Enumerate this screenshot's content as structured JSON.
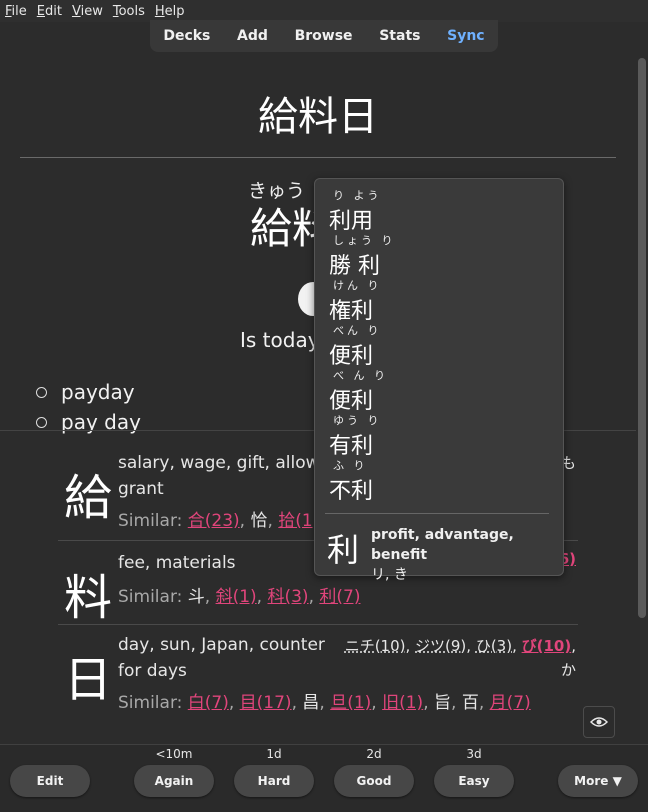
{
  "menubar": {
    "items": [
      {
        "u": "F",
        "rest": "ile"
      },
      {
        "u": "E",
        "rest": "dit"
      },
      {
        "u": "V",
        "rest": "iew"
      },
      {
        "u": "T",
        "rest": "ools"
      },
      {
        "u": "H",
        "rest": "elp"
      }
    ]
  },
  "nav": {
    "decks": "Decks",
    "add": "Add",
    "browse": "Browse",
    "stats": "Stats",
    "sync": "Sync"
  },
  "card": {
    "front": "給料日",
    "reading_visible": "きゅう",
    "back_visible": "給料",
    "sentence_visible": "Is today",
    "meanings": [
      "payday",
      "pay day"
    ]
  },
  "kanji": [
    {
      "char": "給",
      "meaning_l1": "salary, wage, gift, allow",
      "meaning_l2": "grant",
      "sim_label": "Similar: ",
      "sim_items": [
        {
          "t": "合(23)",
          "link": true
        },
        {
          "t": ", ",
          "link": false
        },
        {
          "t": "恰",
          "plain": true
        },
        {
          "t": ", ",
          "link": false
        },
        {
          "t": "拾(1)",
          "link": true
        }
      ],
      "readings_right": "も"
    },
    {
      "char": "料",
      "meaning_l1": "fee, materials",
      "sim_label": "Similar: ",
      "sim_items": [
        {
          "t": "斗",
          "plain": true
        },
        {
          "t": ", ",
          "link": false
        },
        {
          "t": "斜(1)",
          "link": true
        },
        {
          "t": ", ",
          "link": false
        },
        {
          "t": "科(3)",
          "link": true
        },
        {
          "t": ", ",
          "link": false
        },
        {
          "t": "利(7)",
          "link": true
        }
      ],
      "readings_right": "6)"
    },
    {
      "char": "日",
      "meaning_l1": "day, sun, Japan, counter",
      "meaning_l2": "for days",
      "sim_label": "Similar: ",
      "sim_items": [
        {
          "t": "白(7)",
          "link": true
        },
        {
          "t": ", ",
          "link": false
        },
        {
          "t": "目(17)",
          "link": true
        },
        {
          "t": ", ",
          "link": false
        },
        {
          "t": "昌",
          "plain": true
        },
        {
          "t": ", ",
          "link": false
        },
        {
          "t": "旦(1)",
          "link": true
        },
        {
          "t": ", ",
          "link": false
        },
        {
          "t": "旧(1)",
          "link": true
        },
        {
          "t": ", ",
          "link": false
        },
        {
          "t": "旨",
          "plain": true
        },
        {
          "t": ", ",
          "link": false
        },
        {
          "t": "百",
          "plain": true
        },
        {
          "t": ", ",
          "link": false
        },
        {
          "t": "月(7)",
          "link": true
        }
      ],
      "readings": [
        {
          "t": "ニチ(10)",
          "cls": "ul"
        },
        {
          "t": ", ",
          "cls": ""
        },
        {
          "t": "ジツ(9)",
          "cls": "ul"
        },
        {
          "t": ", ",
          "cls": ""
        },
        {
          "t": "ひ(3)",
          "cls": "ul"
        },
        {
          "t": ", ",
          "cls": ""
        },
        {
          "t": "び(10)",
          "cls": "hl"
        },
        {
          "t": ",",
          "cls": ""
        }
      ],
      "readings_l2": "か"
    }
  ],
  "popup": {
    "words": [
      {
        "ruby": "り よう",
        "word": "利用"
      },
      {
        "ruby": "しょう り",
        "word": "勝 利"
      },
      {
        "ruby": "けん り",
        "word": "権利"
      },
      {
        "ruby": "べん り",
        "word": "便利"
      },
      {
        "ruby": "べ ん り",
        "word": "便利"
      },
      {
        "ruby": "ゆう り",
        "word": "有利"
      },
      {
        "ruby": "ふ り",
        "word": "不利"
      }
    ],
    "kanji": "利",
    "definition": "profit, advantage, benefit",
    "def_readings": "リ, き"
  },
  "bottom": {
    "edit": "Edit",
    "again": {
      "label": "Again",
      "time": "<10m"
    },
    "hard": {
      "label": "Hard",
      "time": "1d"
    },
    "good": {
      "label": "Good",
      "time": "2d"
    },
    "easy": {
      "label": "Easy",
      "time": "3d"
    },
    "more": "More ▼"
  }
}
